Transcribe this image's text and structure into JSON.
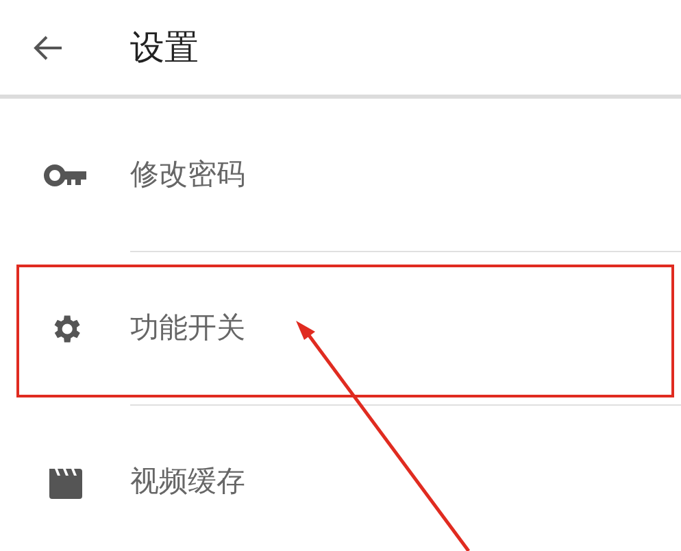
{
  "header": {
    "title": "设置"
  },
  "items": [
    {
      "kind": "key",
      "label": "修改密码",
      "highlighted": false
    },
    {
      "kind": "gear",
      "label": "功能开关",
      "highlighted": true
    },
    {
      "kind": "video",
      "label": "视频缓存",
      "highlighted": false
    }
  ]
}
